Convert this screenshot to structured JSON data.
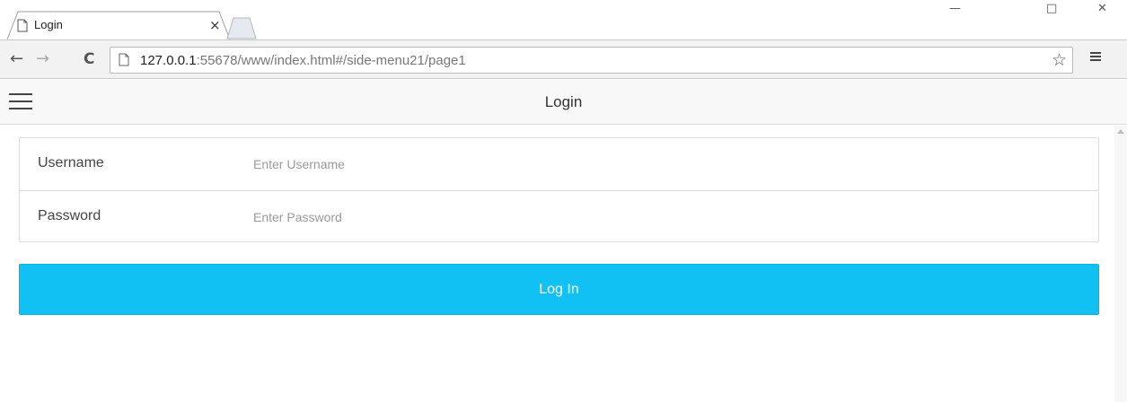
{
  "browser": {
    "tab": {
      "title": "Login",
      "close_glyph": "×",
      "icon": "page-icon"
    },
    "window_controls": {
      "minimize": "—",
      "maximize": "□",
      "close": "✕"
    },
    "nav": {
      "back": "←",
      "forward": "→",
      "reload": "C"
    },
    "address": {
      "host": "127.0.0.1",
      "rest": ":55678/www/index.html#/side-menu21/page1"
    },
    "bookmark_glyph": "☆"
  },
  "app": {
    "header": {
      "title": "Login",
      "menu_icon": "hamburger-icon"
    },
    "form": {
      "username": {
        "label": "Username",
        "placeholder": "Enter Username",
        "value": ""
      },
      "password": {
        "label": "Password",
        "placeholder": "Enter Password",
        "value": ""
      }
    },
    "login_button": {
      "label": "Log In",
      "color": "#11c1f3"
    }
  }
}
